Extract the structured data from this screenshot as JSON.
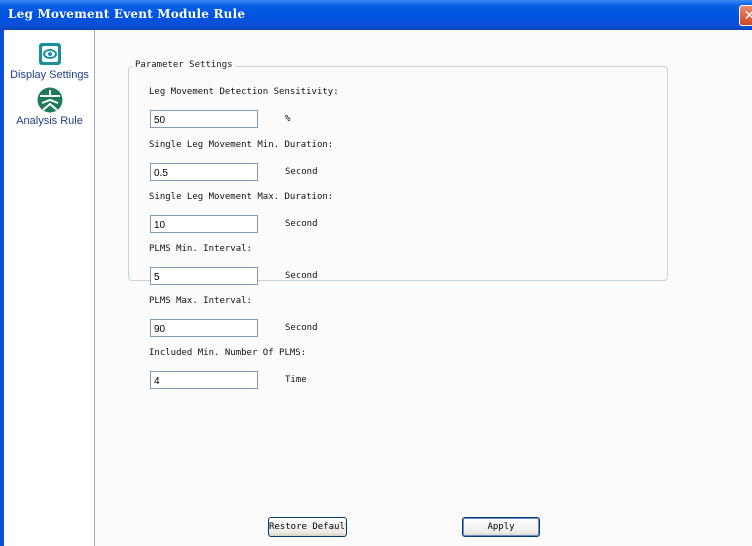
{
  "window": {
    "title": "Leg Movement Event Module Rule",
    "close_label": "✕"
  },
  "sidebar": {
    "items": [
      {
        "label": "Display Settings",
        "icon": "display-icon"
      },
      {
        "label": "Analysis Rule",
        "icon": "analysis-rule-icon"
      }
    ]
  },
  "group": {
    "legend": "Parameter Settings"
  },
  "fields": [
    {
      "label": "Leg Movement Detection Sensitivity:",
      "value": "50",
      "unit": "%"
    },
    {
      "label": "Single Leg Movement Min. Duration:",
      "value": "0.5",
      "unit": "Second"
    },
    {
      "label": "Single Leg Movement Max. Duration:",
      "value": "10",
      "unit": "Second"
    },
    {
      "label": "PLMS Min. Interval:",
      "value": "5",
      "unit": "Second"
    },
    {
      "label": "PLMS Max. Interval:",
      "value": "90",
      "unit": "Second"
    },
    {
      "label": "Included Min. Number Of PLMS:",
      "value": "4",
      "unit": "Time"
    }
  ],
  "buttons": {
    "restore_label": "Restore Default",
    "apply_label": "Apply"
  },
  "colors": {
    "title_bar": "#0053e0",
    "sidebar_text": "#1f3f8a",
    "input_border": "#7f9db9"
  }
}
